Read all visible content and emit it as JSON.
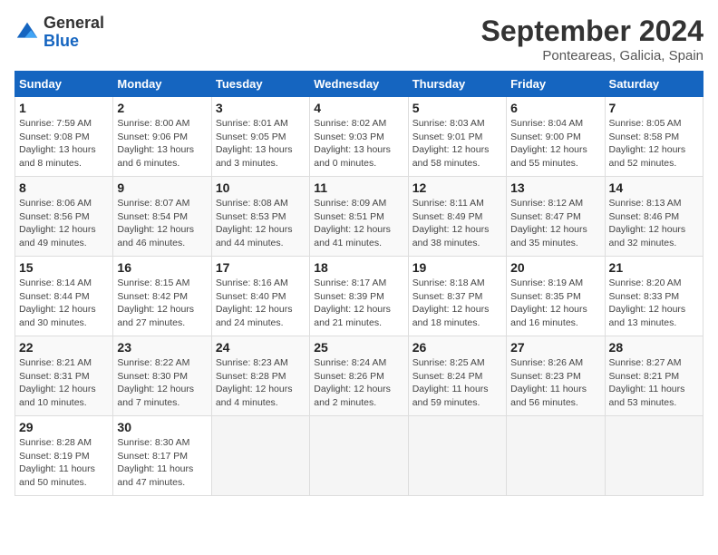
{
  "logo": {
    "text_general": "General",
    "text_blue": "Blue"
  },
  "title": "September 2024",
  "subtitle": "Ponteareas, Galicia, Spain",
  "days_of_week": [
    "Sunday",
    "Monday",
    "Tuesday",
    "Wednesday",
    "Thursday",
    "Friday",
    "Saturday"
  ],
  "weeks": [
    [
      {
        "day": "1",
        "sunrise": "7:59 AM",
        "sunset": "9:08 PM",
        "daylight": "13 hours and 8 minutes."
      },
      {
        "day": "2",
        "sunrise": "8:00 AM",
        "sunset": "9:06 PM",
        "daylight": "13 hours and 6 minutes."
      },
      {
        "day": "3",
        "sunrise": "8:01 AM",
        "sunset": "9:05 PM",
        "daylight": "13 hours and 3 minutes."
      },
      {
        "day": "4",
        "sunrise": "8:02 AM",
        "sunset": "9:03 PM",
        "daylight": "13 hours and 0 minutes."
      },
      {
        "day": "5",
        "sunrise": "8:03 AM",
        "sunset": "9:01 PM",
        "daylight": "12 hours and 58 minutes."
      },
      {
        "day": "6",
        "sunrise": "8:04 AM",
        "sunset": "9:00 PM",
        "daylight": "12 hours and 55 minutes."
      },
      {
        "day": "7",
        "sunrise": "8:05 AM",
        "sunset": "8:58 PM",
        "daylight": "12 hours and 52 minutes."
      }
    ],
    [
      {
        "day": "8",
        "sunrise": "8:06 AM",
        "sunset": "8:56 PM",
        "daylight": "12 hours and 49 minutes."
      },
      {
        "day": "9",
        "sunrise": "8:07 AM",
        "sunset": "8:54 PM",
        "daylight": "12 hours and 46 minutes."
      },
      {
        "day": "10",
        "sunrise": "8:08 AM",
        "sunset": "8:53 PM",
        "daylight": "12 hours and 44 minutes."
      },
      {
        "day": "11",
        "sunrise": "8:09 AM",
        "sunset": "8:51 PM",
        "daylight": "12 hours and 41 minutes."
      },
      {
        "day": "12",
        "sunrise": "8:11 AM",
        "sunset": "8:49 PM",
        "daylight": "12 hours and 38 minutes."
      },
      {
        "day": "13",
        "sunrise": "8:12 AM",
        "sunset": "8:47 PM",
        "daylight": "12 hours and 35 minutes."
      },
      {
        "day": "14",
        "sunrise": "8:13 AM",
        "sunset": "8:46 PM",
        "daylight": "12 hours and 32 minutes."
      }
    ],
    [
      {
        "day": "15",
        "sunrise": "8:14 AM",
        "sunset": "8:44 PM",
        "daylight": "12 hours and 30 minutes."
      },
      {
        "day": "16",
        "sunrise": "8:15 AM",
        "sunset": "8:42 PM",
        "daylight": "12 hours and 27 minutes."
      },
      {
        "day": "17",
        "sunrise": "8:16 AM",
        "sunset": "8:40 PM",
        "daylight": "12 hours and 24 minutes."
      },
      {
        "day": "18",
        "sunrise": "8:17 AM",
        "sunset": "8:39 PM",
        "daylight": "12 hours and 21 minutes."
      },
      {
        "day": "19",
        "sunrise": "8:18 AM",
        "sunset": "8:37 PM",
        "daylight": "12 hours and 18 minutes."
      },
      {
        "day": "20",
        "sunrise": "8:19 AM",
        "sunset": "8:35 PM",
        "daylight": "12 hours and 16 minutes."
      },
      {
        "day": "21",
        "sunrise": "8:20 AM",
        "sunset": "8:33 PM",
        "daylight": "12 hours and 13 minutes."
      }
    ],
    [
      {
        "day": "22",
        "sunrise": "8:21 AM",
        "sunset": "8:31 PM",
        "daylight": "12 hours and 10 minutes."
      },
      {
        "day": "23",
        "sunrise": "8:22 AM",
        "sunset": "8:30 PM",
        "daylight": "12 hours and 7 minutes."
      },
      {
        "day": "24",
        "sunrise": "8:23 AM",
        "sunset": "8:28 PM",
        "daylight": "12 hours and 4 minutes."
      },
      {
        "day": "25",
        "sunrise": "8:24 AM",
        "sunset": "8:26 PM",
        "daylight": "12 hours and 2 minutes."
      },
      {
        "day": "26",
        "sunrise": "8:25 AM",
        "sunset": "8:24 PM",
        "daylight": "11 hours and 59 minutes."
      },
      {
        "day": "27",
        "sunrise": "8:26 AM",
        "sunset": "8:23 PM",
        "daylight": "11 hours and 56 minutes."
      },
      {
        "day": "28",
        "sunrise": "8:27 AM",
        "sunset": "8:21 PM",
        "daylight": "11 hours and 53 minutes."
      }
    ],
    [
      {
        "day": "29",
        "sunrise": "8:28 AM",
        "sunset": "8:19 PM",
        "daylight": "11 hours and 50 minutes."
      },
      {
        "day": "30",
        "sunrise": "8:30 AM",
        "sunset": "8:17 PM",
        "daylight": "11 hours and 47 minutes."
      },
      null,
      null,
      null,
      null,
      null
    ]
  ]
}
